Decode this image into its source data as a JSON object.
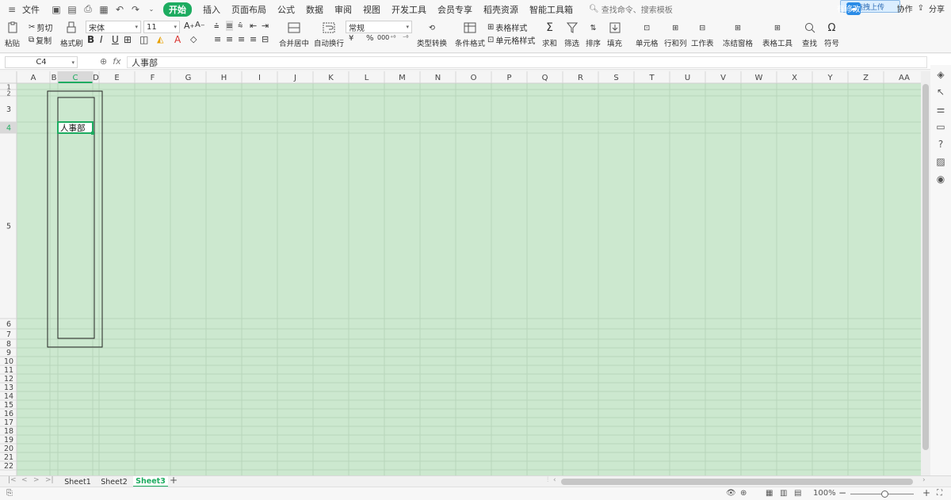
{
  "menubar": {
    "file": "文件",
    "tabs": [
      {
        "label": "开始",
        "active": true
      },
      {
        "label": "插入"
      },
      {
        "label": "页面布局"
      },
      {
        "label": "公式"
      },
      {
        "label": "数据"
      },
      {
        "label": "审阅"
      },
      {
        "label": "视图"
      },
      {
        "label": "开发工具"
      },
      {
        "label": "会员专享"
      },
      {
        "label": "稻壳资源"
      },
      {
        "label": "智能工具箱"
      }
    ],
    "search_placeholder": "查找命令、搜索模板",
    "upload_tip": "拖拽上传",
    "right_items": [
      "有修改",
      "协作",
      "分享"
    ]
  },
  "ribbon": {
    "paste": "粘贴",
    "cut": "剪切",
    "copy": "复制",
    "format_painter": "格式刷",
    "font_name": "宋体",
    "font_size": "11",
    "number_format": "常规",
    "merge_center": "合并居中",
    "wrap_text": "自动换行",
    "type_convert": "类型转换",
    "conditional_format": "条件格式",
    "table_style": "表格样式",
    "cell_style": "单元格样式",
    "sum": "求和",
    "filter": "筛选",
    "sort": "排序",
    "fill": "填充",
    "cell": "单元格",
    "row_col": "行和列",
    "worksheet": "工作表",
    "freeze": "冻结窗格",
    "table_tools": "表格工具",
    "find": "查找",
    "symbol": "符号",
    "currency_symbol": "¥",
    "percent_symbol": "%",
    "thousands_symbol": "000"
  },
  "formulabar": {
    "name_box": "C4",
    "fx_label": "fx",
    "content": "人事部"
  },
  "grid": {
    "columns": [
      "A",
      "B",
      "C",
      "D",
      "E",
      "F",
      "G",
      "H",
      "I",
      "J",
      "K",
      "L",
      "M",
      "N",
      "O",
      "P",
      "Q",
      "R",
      "S",
      "T",
      "U",
      "V",
      "W",
      "X",
      "Y",
      "Z",
      "AA"
    ],
    "rows": [
      "1",
      "2",
      "3",
      "4",
      "5",
      "6",
      "7",
      "8",
      "9",
      "10",
      "11",
      "12",
      "13",
      "14",
      "15",
      "16",
      "17",
      "18",
      "19",
      "20",
      "21",
      "22"
    ],
    "selected_cell": "C4",
    "cell_text": "人事部",
    "background": "#cce8cf",
    "accent": "#1dac60"
  },
  "sheets": {
    "tabs": [
      {
        "label": "Sheet1"
      },
      {
        "label": "Sheet2"
      },
      {
        "label": "Sheet3",
        "active": true
      }
    ],
    "add": "+"
  },
  "statusbar": {
    "zoom": "100%",
    "minus": "−",
    "plus": "+"
  }
}
